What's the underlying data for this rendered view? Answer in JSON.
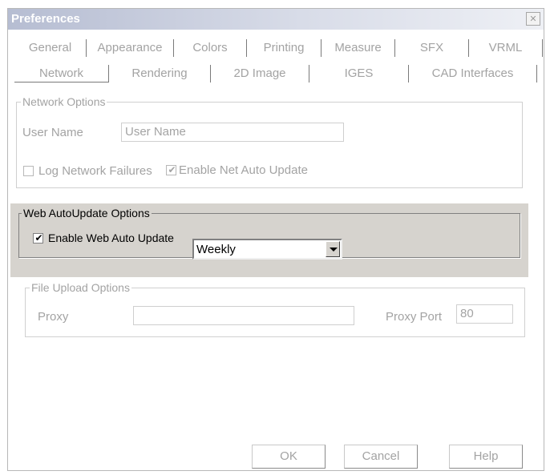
{
  "window": {
    "title": "Preferences",
    "close_glyph": "✕"
  },
  "tabs": {
    "row1": [
      "General",
      "Appearance",
      "Colors",
      "Printing",
      "Measure",
      "SFX",
      "VRML"
    ],
    "row2": [
      "Network",
      "Rendering",
      "2D Image",
      "IGES",
      "CAD Interfaces"
    ],
    "active": "Network"
  },
  "network_options": {
    "legend": "Network Options",
    "user_name_label": "User Name",
    "user_name_value": "User Name",
    "log_failures_label": "Log Network Failures",
    "log_failures_checked": false,
    "net_auto_update_label": "Enable Net Auto Update",
    "net_auto_update_checked": true
  },
  "web_autoupdate": {
    "legend": "Web AutoUpdate Options",
    "enable_label": "Enable Web Auto Update",
    "enable_checked": true,
    "frequency_value": "Weekly"
  },
  "file_upload": {
    "legend": "File Upload Options",
    "proxy_label": "Proxy",
    "proxy_value": "",
    "proxy_port_label": "Proxy Port",
    "proxy_port_value": "80"
  },
  "buttons": {
    "ok": "OK",
    "cancel": "Cancel",
    "help": "Help"
  },
  "check_glyph": "✔"
}
